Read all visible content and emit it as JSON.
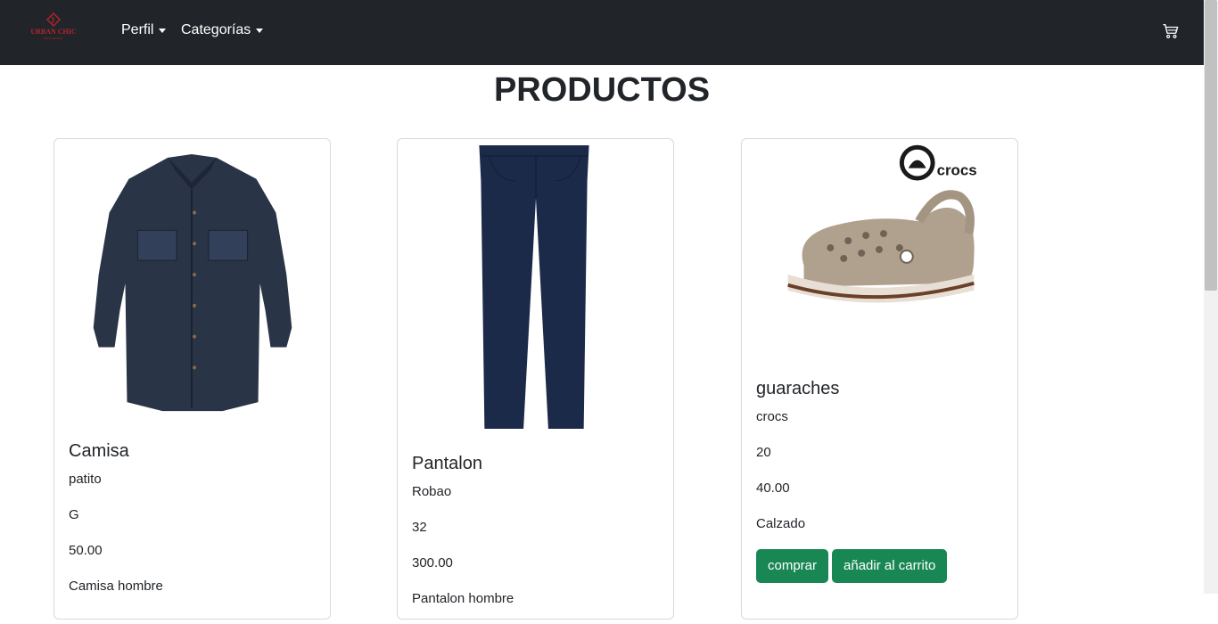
{
  "brand": {
    "logo_text": "URBAN CHIC",
    "logo_subtext": "ES TU ESTILO",
    "logo_color": "#b3242a"
  },
  "nav": {
    "items": [
      {
        "label": "Perfil"
      },
      {
        "label": "Categorías"
      }
    ],
    "cart_icon": "cart-icon"
  },
  "page": {
    "title": "PRODUCTOS"
  },
  "products": [
    {
      "name": "Camisa",
      "brand": "patito",
      "size": "G",
      "price": "50.00",
      "category": "Camisa hombre"
    },
    {
      "name": "Pantalon",
      "brand": "Robao",
      "size": "32",
      "price": "300.00",
      "category": "Pantalon hombre"
    },
    {
      "name": "guaraches",
      "brand": "crocs",
      "size": "20",
      "price": "40.00",
      "category": "Calzado",
      "buy_label": "comprar",
      "add_label": "añadir al carrito",
      "logo_text": "crocs"
    }
  ],
  "colors": {
    "navbar": "#212529",
    "button": "#198754"
  }
}
